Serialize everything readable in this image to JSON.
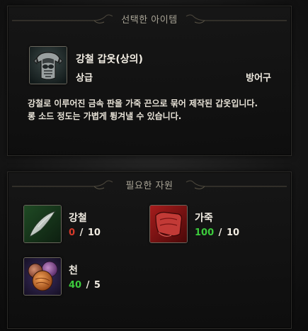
{
  "selected_panel": {
    "title": "선택한 아이템",
    "item": {
      "name": "강철 갑옷(상의)",
      "grade": "상급",
      "type": "방어구",
      "icon": "armor-icon",
      "description_line1": "강철로 이루어진 금속 판을 가죽 끈으로 묶어 제작된 갑옷입니다.",
      "description_line2": "롱 소드 정도는 가볍게 튕겨낼 수 있습니다."
    }
  },
  "resources_panel": {
    "title": "필요한 자원",
    "resources": [
      {
        "name": "강철",
        "icon": "steel-icon",
        "current": "0",
        "separator": "/",
        "required": "10",
        "status": "insufficient"
      },
      {
        "name": "가죽",
        "icon": "leather-icon",
        "current": "100",
        "separator": "/",
        "required": "10",
        "status": "sufficient"
      },
      {
        "name": "천",
        "icon": "cloth-icon",
        "current": "40",
        "separator": "/",
        "required": "5",
        "status": "sufficient"
      }
    ]
  },
  "colors": {
    "insufficient": "#d63a2a",
    "sufficient": "#3ccb3c",
    "title": "#a9a496",
    "text": "#f2ede3"
  }
}
